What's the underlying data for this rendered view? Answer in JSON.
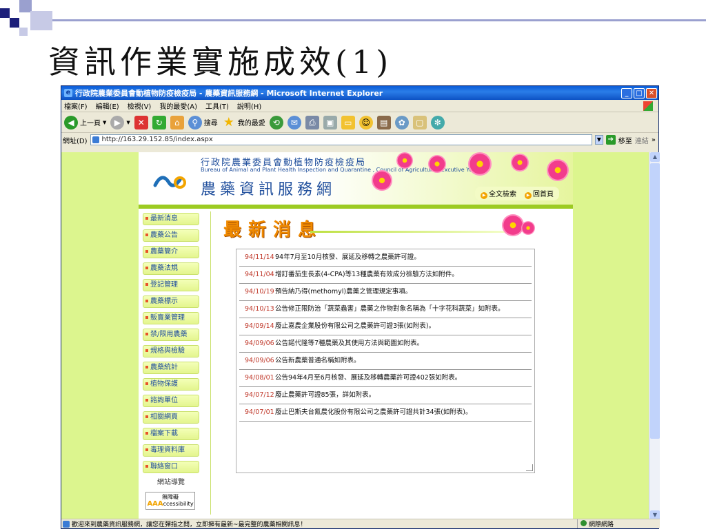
{
  "slide": {
    "title": "資訊作業實施成效(1)"
  },
  "window": {
    "title": "行政院農業委員會動植物防疫檢疫局 - 農藥資訊服務網 - Microsoft Internet Explorer",
    "menu": [
      "檔案(F)",
      "編輯(E)",
      "檢視(V)",
      "我的最愛(A)",
      "工具(T)",
      "說明(H)"
    ],
    "toolbar": {
      "back": "上一頁",
      "search": "搜尋",
      "favorites": "我的最愛"
    },
    "address_label": "網址(D)",
    "address": "http://163.29.152.85/index.aspx",
    "go": "移至",
    "links": "連結",
    "status": "歡迎來到農藥資訊服務網，讓您在彈指之間，立即擁有最新~最完整的農藥相關訊息！",
    "zone": "網際網路"
  },
  "site": {
    "org_cn": "行政院農業委員會動植物防疫檢疫局",
    "org_en": "Bureau of Animal and Plant Health Inspection and Quarantine , Council of Agriculture , Excutive Yuan",
    "name": "農藥資訊服務網",
    "topnav": [
      "全文檢索",
      "回首頁"
    ],
    "sidenav": [
      "最新消息",
      "農藥公告",
      "農藥簡介",
      "農藥法規",
      "登記管理",
      "農藥標示",
      "販賣業管理",
      "禁/限用農藥",
      "規格與檢驗",
      "農藥統計",
      "植物保護",
      "諮詢單位",
      "相關網頁",
      "檔案下載",
      "毒理資料庫",
      "聯絡窗口"
    ],
    "sitemap": "網站導覽",
    "accessibility": {
      "label": "無障礙",
      "mark": "AAA",
      "sub": "ccessibility"
    },
    "news_title": "最新消息",
    "news": [
      {
        "date": "94/11/14",
        "text": "94年7月至10月核發、展延及移轉之農藥許可證。"
      },
      {
        "date": "94/11/04",
        "text": "增訂番茄生長素(4-CPA)等13種農藥有效成分檢驗方法如附件。"
      },
      {
        "date": "94/10/19",
        "text": "預告納乃得(methomyl)農藥之管理規定事項。"
      },
      {
        "date": "94/10/13",
        "text": "公告修正限防治「蔬菜蟲害」農藥之作物對象名稱為「十字花科蔬菜」如附表。"
      },
      {
        "date": "94/09/14",
        "text": "廢止嘉農企業股份有限公司之農藥許可證3張(如附表)。"
      },
      {
        "date": "94/09/06",
        "text": "公告諾代隆等7種農藥及其使用方法與範圍如附表。"
      },
      {
        "date": "94/09/06",
        "text": "公告新農藥普通名稱如附表。"
      },
      {
        "date": "94/08/01",
        "text": "公告94年4月至6月核發、展延及移轉農藥許可證402張如附表。"
      },
      {
        "date": "94/07/12",
        "text": "廢止農藥許可證85張，詳如附表。"
      },
      {
        "date": "94/07/01",
        "text": "廢止巴斯夫台氰農化股份有限公司之農藥許可證共計34張(如附表)。"
      }
    ]
  }
}
